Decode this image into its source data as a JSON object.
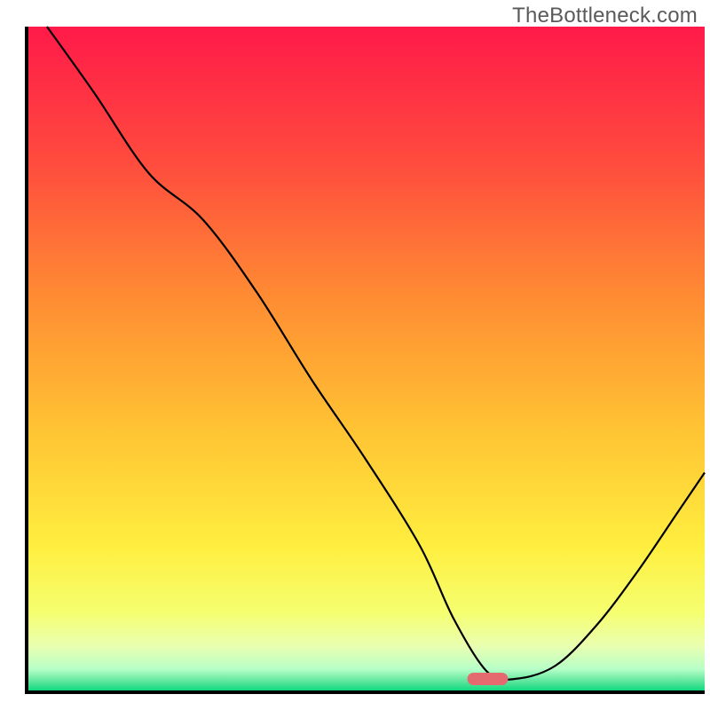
{
  "watermark": "TheBottleneck.com",
  "colors": {
    "border": "#000000",
    "curve": "#000000",
    "marker_fill": "#e46a6f",
    "gradient_stops": [
      {
        "offset": 0.0,
        "color": "#ff1a49"
      },
      {
        "offset": 0.2,
        "color": "#ff4a3e"
      },
      {
        "offset": 0.4,
        "color": "#ff8a33"
      },
      {
        "offset": 0.6,
        "color": "#ffc233"
      },
      {
        "offset": 0.78,
        "color": "#ffee3f"
      },
      {
        "offset": 0.88,
        "color": "#f5ff70"
      },
      {
        "offset": 0.93,
        "color": "#eaffb0"
      },
      {
        "offset": 0.965,
        "color": "#b8ffc8"
      },
      {
        "offset": 0.985,
        "color": "#55e49a"
      },
      {
        "offset": 1.0,
        "color": "#00d97a"
      }
    ]
  },
  "chart_data": {
    "type": "line",
    "title": "",
    "xlabel": "",
    "ylabel": "",
    "xlim": [
      0,
      100
    ],
    "ylim": [
      0,
      100
    ],
    "grid": false,
    "legend": false,
    "annotations": [
      "TheBottleneck.com"
    ],
    "marker": {
      "x": 68,
      "y": 2,
      "width": 6,
      "height": 2
    },
    "series": [
      {
        "name": "curve",
        "x": [
          3,
          10,
          18,
          26,
          34,
          42,
          50,
          58,
          63,
          68,
          72,
          78,
          84,
          90,
          96,
          100
        ],
        "values": [
          100,
          90,
          78,
          71,
          60,
          47,
          35,
          22,
          11,
          3,
          2,
          4,
          10,
          18,
          27,
          33
        ]
      }
    ]
  }
}
